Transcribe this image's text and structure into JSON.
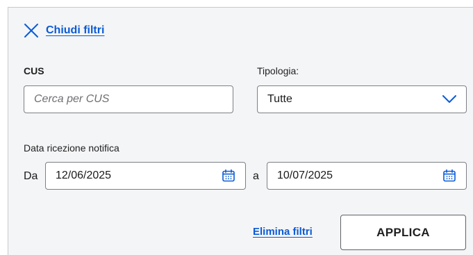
{
  "filters": {
    "close_label": "Chiudi filtri",
    "cus": {
      "label": "CUS",
      "placeholder": "Cerca per CUS",
      "value": ""
    },
    "tipologia": {
      "label": "Tipologia:",
      "selected": "Tutte"
    },
    "date": {
      "label": "Data ricezione notifica",
      "from_label": "Da",
      "from_value": "12/06/2025",
      "to_label": "a",
      "to_value": "10/07/2025"
    },
    "clear_label": "Elimina filtri",
    "apply_label": "APPLICA"
  },
  "colors": {
    "accent": "#0a5bd6",
    "panel_bg": "#f4f5f7"
  },
  "icons": {
    "close": "close-icon",
    "chevron": "chevron-down-icon",
    "calendar": "calendar-icon"
  }
}
